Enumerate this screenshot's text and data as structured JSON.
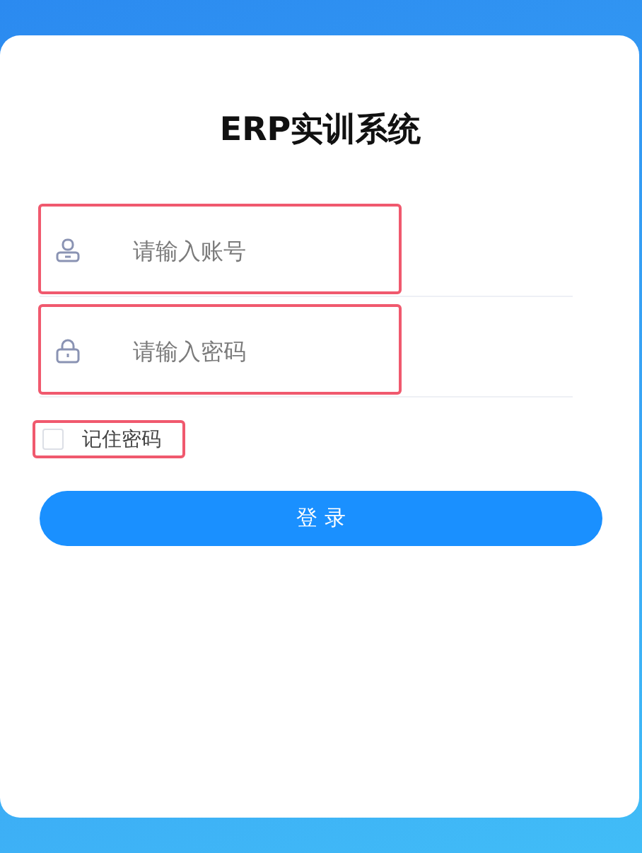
{
  "title": "ERP实训系统",
  "fields": [
    {
      "kind": "user",
      "placeholder": "请输入账号",
      "highlighted": true
    },
    {
      "kind": "lock",
      "placeholder": "请输入密码",
      "highlighted": true
    }
  ],
  "remember": {
    "label": "记住密码",
    "checked": false,
    "highlighted": true
  },
  "login_button": "登 录"
}
